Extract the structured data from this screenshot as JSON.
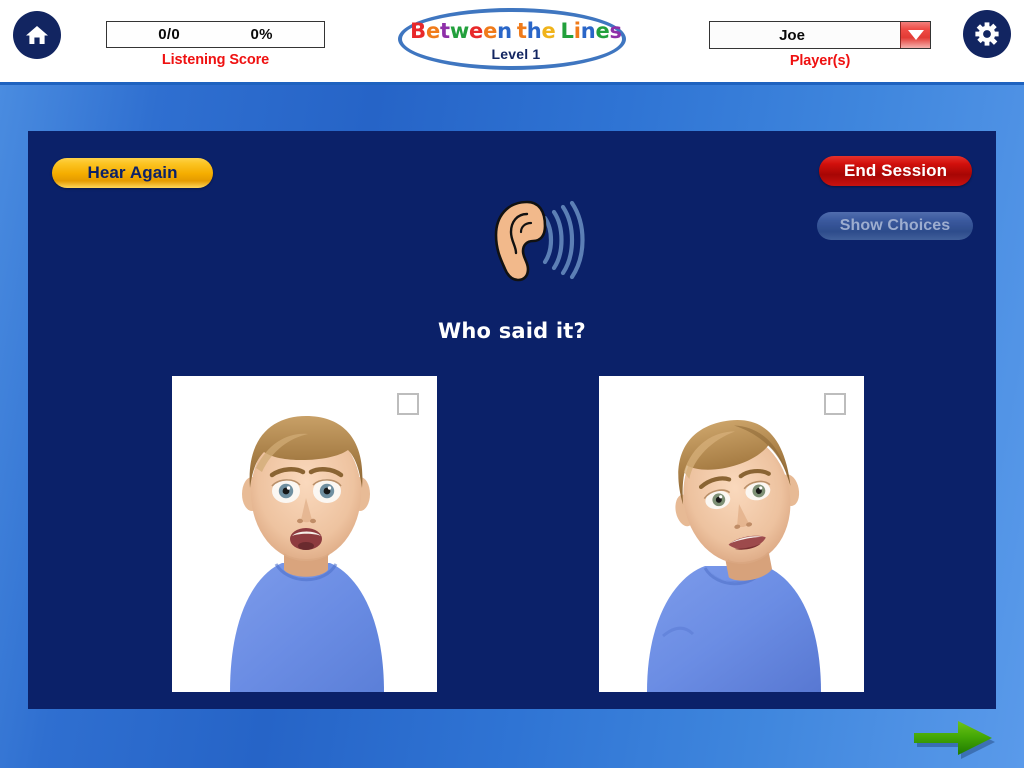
{
  "header": {
    "home_icon": "home-icon",
    "gear_icon": "gear-icon",
    "score": {
      "fraction": "0/0",
      "percent": "0%",
      "caption": "Listening Score"
    },
    "player": {
      "selected": "Joe",
      "caption": "Player(s)",
      "dropdown_icon": "chevron-down-icon"
    },
    "title": {
      "letters": [
        {
          "ch": "B",
          "color": "#e8282a"
        },
        {
          "ch": "e",
          "color": "#f07b1a"
        },
        {
          "ch": "t",
          "color": "#8e2fa8"
        },
        {
          "ch": "w",
          "color": "#22a03c"
        },
        {
          "ch": "e",
          "color": "#e8282a"
        },
        {
          "ch": "e",
          "color": "#f07b1a"
        },
        {
          "ch": "n",
          "color": "#2a66c8"
        },
        {
          "ch": "t",
          "color": "#f07b1a"
        },
        {
          "ch": "h",
          "color": "#2a66c8"
        },
        {
          "ch": "e",
          "color": "#f0b31a"
        },
        {
          "ch": "L",
          "color": "#22a03c"
        },
        {
          "ch": "i",
          "color": "#f07b1a"
        },
        {
          "ch": "n",
          "color": "#2a66c8"
        },
        {
          "ch": "e",
          "color": "#22a03c"
        },
        {
          "ch": "s",
          "color": "#8e2fa8"
        }
      ],
      "word_breaks": [
        7,
        10
      ],
      "subtitle": "Level 1"
    }
  },
  "panel": {
    "hear_again_label": "Hear Again",
    "end_session_label": "End Session",
    "show_choices_label": "Show Choices",
    "ear_icon": "ear-listening-icon",
    "question": "Who said it?",
    "choices": [
      {
        "name": "choice-left",
        "description": "Photo of a boy with a surprised, wide-eyed, open-mouth expression wearing a blue t-shirt",
        "checked": false
      },
      {
        "name": "choice-right",
        "description": "Photo of a boy with head tilted and a questioning, skeptical expression wearing a blue t-shirt",
        "checked": false
      }
    ]
  },
  "footer": {
    "next_icon": "next-arrow-icon"
  },
  "colors": {
    "panel_navy": "#0b2169",
    "accent_red": "#ef1111",
    "gold": "#f5ad00",
    "green_arrow": "#3fa80b",
    "header_white": "#ffffff"
  }
}
